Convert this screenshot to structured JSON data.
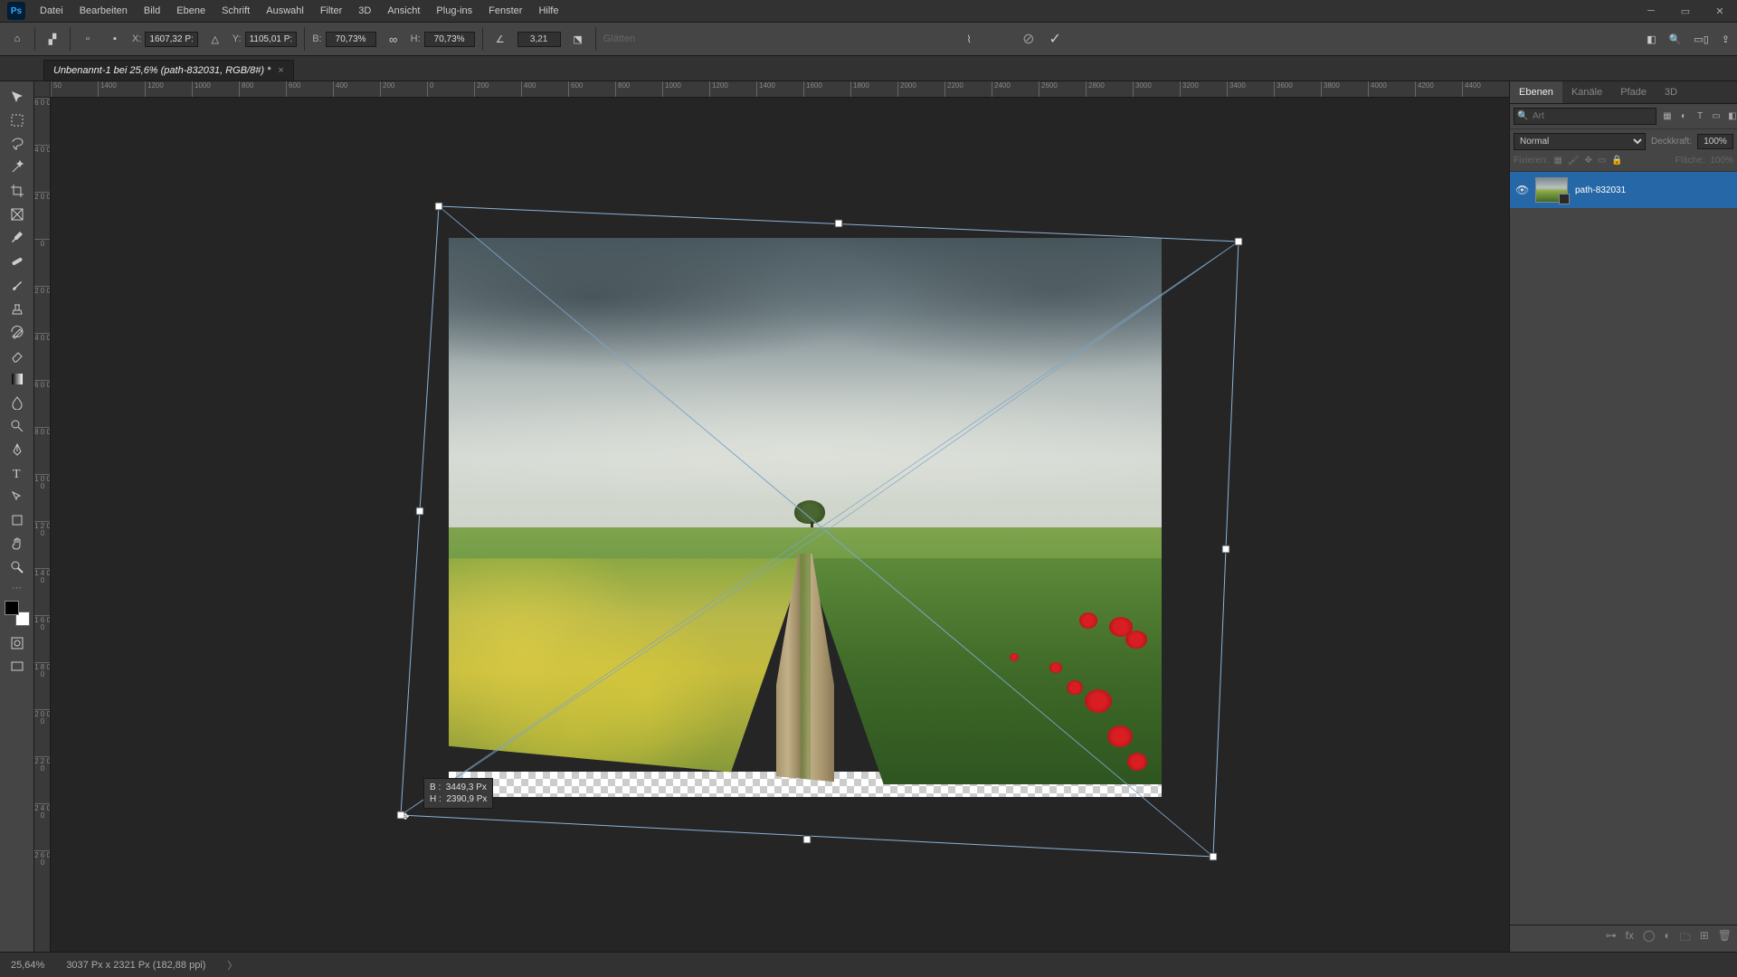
{
  "menubar": [
    "Datei",
    "Bearbeiten",
    "Bild",
    "Ebene",
    "Schrift",
    "Auswahl",
    "Filter",
    "3D",
    "Ansicht",
    "Plug-ins",
    "Fenster",
    "Hilfe"
  ],
  "options": {
    "x_label": "X:",
    "x_val": "1607,32 P:",
    "y_label": "Y:",
    "y_val": "1105,01 P:",
    "w_label": "B:",
    "w_val": "70,73%",
    "h_label": "H:",
    "h_val": "70,73%",
    "angle_val": "3,21",
    "glatten": "Glätten"
  },
  "doc_tab": "Unbenannt-1 bei 25,6% (path-832031, RGB/8#) *",
  "ruler_h": [
    "50",
    "1400",
    "1200",
    "1000",
    "800",
    "600",
    "400",
    "200",
    "0",
    "200",
    "400",
    "600",
    "800",
    "1000",
    "1200",
    "1400",
    "1600",
    "1800",
    "2000",
    "2200",
    "2400",
    "2600",
    "2800",
    "3000",
    "3200",
    "3400",
    "3600",
    "3800",
    "4000",
    "4200",
    "4400"
  ],
  "ruler_v": [
    "6\n0\n0",
    "4\n0\n0",
    "2\n0\n0",
    "0",
    "2\n0\n0",
    "4\n0\n0",
    "6\n0\n0",
    "8\n0\n0",
    "1\n0\n0\n0",
    "1\n2\n0\n0",
    "1\n4\n0\n0",
    "1\n6\n0\n0",
    "1\n8\n0\n0",
    "2\n0\n0\n0",
    "2\n2\n0\n0",
    "2\n4\n0\n0",
    "2\n6\n0\n0"
  ],
  "tooltip": {
    "b_label": "B :",
    "b_val": "3449,3 Px",
    "h_label": "H :",
    "h_val": "2390,9 Px"
  },
  "panels": {
    "tabs": [
      "Ebenen",
      "Kanäle",
      "Pfade",
      "3D"
    ],
    "search_placeholder": "Art",
    "blend_mode": "Normal",
    "opacity_label": "Deckkraft:",
    "opacity_val": "100%",
    "lock_label": "Fixieren:",
    "fill_label": "Fläche:",
    "fill_val": "100%",
    "layer_name": "path-832031"
  },
  "status": {
    "zoom": "25,64%",
    "info": "3037 Px x 2321 Px (182,88 ppi)"
  }
}
